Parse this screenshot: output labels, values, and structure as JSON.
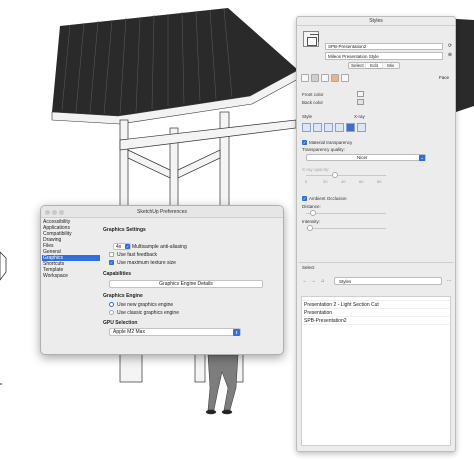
{
  "styles_tray": {
    "title": "Styles",
    "style_name": "SPB-Presentation2",
    "style_description": "Mileos Presentation Style",
    "tabs": [
      {
        "label": "Select",
        "active": false
      },
      {
        "label": "Edit",
        "active": true
      },
      {
        "label": "Mix",
        "active": false
      }
    ],
    "face_label": "Face",
    "front_color_label": "Front color",
    "back_color_label": "Back color",
    "style_label": "Style",
    "xray_label": "X-ray",
    "material_transparency_label": "Material transparency",
    "material_transparency_checked": true,
    "transparency_quality_label": "Transparency quality:",
    "transparency_quality_value": "Nicer",
    "xray_opacity_label": "X-ray opacity:",
    "opacity_ticks": [
      "0",
      "20",
      "40",
      "60",
      "80"
    ],
    "ambient_occlusion_label": "Ambient Occlusion",
    "ambient_occlusion_checked": true,
    "distance_label": "Distance:",
    "intensity_label": "Intensity:",
    "select_header": "Select",
    "nav_select_value": "Styles",
    "list_items": [
      "Presentation 2 - Light Section Cut",
      "Presentation",
      "SPB-Presentation2"
    ]
  },
  "preferences": {
    "title": "SketchUp Preferences",
    "sidebar": [
      {
        "label": "Accessibility",
        "selected": false
      },
      {
        "label": "Applications",
        "selected": false
      },
      {
        "label": "Compatibility",
        "selected": false
      },
      {
        "label": "Drawing",
        "selected": false
      },
      {
        "label": "Files",
        "selected": false
      },
      {
        "label": "General",
        "selected": false
      },
      {
        "label": "Graphics",
        "selected": true
      },
      {
        "label": "Shortcuts",
        "selected": false
      },
      {
        "label": "Template",
        "selected": false
      },
      {
        "label": "Workspace",
        "selected": false
      }
    ],
    "graphics_settings_heading": "Graphics Settings",
    "aa_select_value": "4x",
    "multisample_label": "Multisample anti-aliasing",
    "multisample_checked": true,
    "fast_feedback_label": "Use fast feedback",
    "fast_feedback_checked": false,
    "max_texture_label": "Use maximum texture size",
    "max_texture_checked": true,
    "capabilities_heading": "Capabilities",
    "details_button": "Graphics Engine Details",
    "engine_heading": "Graphics Engine",
    "new_engine_label": "Use new graphics engine",
    "classic_engine_label": "Use classic graphics engine",
    "selected_engine": "new",
    "gpu_heading": "GPU Selection",
    "gpu_value": "Apple M2 Max"
  }
}
